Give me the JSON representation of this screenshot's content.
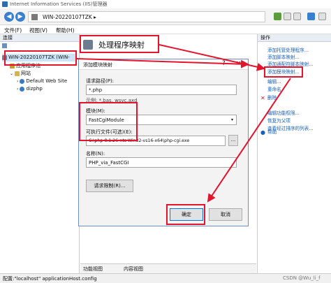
{
  "window": {
    "title": "Internet Information Services (IIS)管理器"
  },
  "address": {
    "path": "WIN-20220107TZK  ▸"
  },
  "menu": {
    "file": "文件(F)",
    "view": "视图(V)",
    "help": "帮助(H)"
  },
  "left_pane": {
    "header": "连接",
    "server": "WIN-20220107TZK (WIN-",
    "app_pools": "应用程序池",
    "sites": "网站",
    "site1": "Default Web Site",
    "site2": "dizphp"
  },
  "main": {
    "title": "处理程序映射"
  },
  "dialog": {
    "title": "添加模块映射",
    "help": "?",
    "close": "×",
    "request_path_label": "请求路径(P):",
    "request_path_value": "*.php",
    "example": "示例: *.bas, wsvc.axd",
    "module_label": "模块(M):",
    "module_value": "FastCgiModule",
    "exe_label": "可执行文件(可选)(E):",
    "exe_value": "C:\\php-8.1.26-nts-Win32-vs16-x64\\php-cgi.exe",
    "browse": "...",
    "name_label": "名称(N):",
    "name_value": "PHP_via_FastCGI",
    "restrictions_button": "请求限制(R)...",
    "ok_button": "确定",
    "cancel_button": "取消"
  },
  "right_pane": {
    "header": "操作",
    "actions": [
      "添加托管处理程序...",
      "添加脚本映射...",
      "添加通配符脚本映射...",
      "添加模块映射...",
      "编辑...",
      "重命名",
      "删除",
      "编辑功能权限...",
      "恢复为父项",
      "查看经过排序的列表...",
      "帮助"
    ]
  },
  "view_tabs": {
    "features": "功能视图",
    "content": "内容视图"
  },
  "status": {
    "text": "配置:\"localhost\" applicationHost.config",
    "watermark": "CSDN @Wu_li_f"
  },
  "colors": {
    "highlight_red": "#e3142d",
    "link_blue": "#1a5fb4",
    "nav_blue": "#3b7fd1"
  }
}
